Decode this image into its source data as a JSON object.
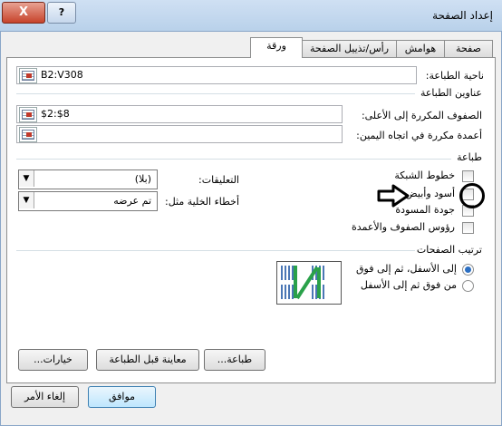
{
  "window": {
    "title": "إعداد الصفحة",
    "close_symbol": "X",
    "help_symbol": "?"
  },
  "tabs": [
    {
      "label": "صفحة"
    },
    {
      "label": "هوامش"
    },
    {
      "label": "رأس/تذييل الصفحة"
    },
    {
      "label": "ورقة"
    }
  ],
  "print_area": {
    "label": "ناحية الطباعة:",
    "value": "B2:V308"
  },
  "print_titles": {
    "header": "عناوين الطباعة",
    "rows_label": "الصفوف المكررة إلى الأعلى:",
    "rows_value": "$2:$8",
    "cols_label": "أعمدة مكررة في اتجاه اليمين:",
    "cols_value": ""
  },
  "print": {
    "header": "طباعة",
    "gridlines": "خطوط الشبكة",
    "black_white": "أسود وأبيض",
    "draft_quality": "جودة المسودة",
    "row_col_headings": "رؤوس الصفوف والأعمدة",
    "comments_label": "التعليقات:",
    "comments_value": "(بلا)",
    "errors_label": "أخطاء الخلية مثل:",
    "errors_value": "تم عرضه"
  },
  "page_order": {
    "header": "ترتيب الصفحات",
    "down_then_over": "إلى الأسفل، ثم إلى فوق",
    "over_then_down": "من فوق ثم إلى الأسفل"
  },
  "buttons": {
    "print": "طباعة...",
    "print_preview": "معاينة قبل الطباعة",
    "options": "خيارات...",
    "ok": "موافق",
    "cancel": "إلغاء الأمر"
  },
  "colors": {
    "title_bar": "#b9d1ea",
    "close_button": "#c7432b",
    "accent": "#2c6fc2"
  },
  "icons": {
    "range_picker": "collapse-dialog-icon",
    "dropdown": "chevron-down-icon",
    "annotation": "arrow-right-icon"
  }
}
